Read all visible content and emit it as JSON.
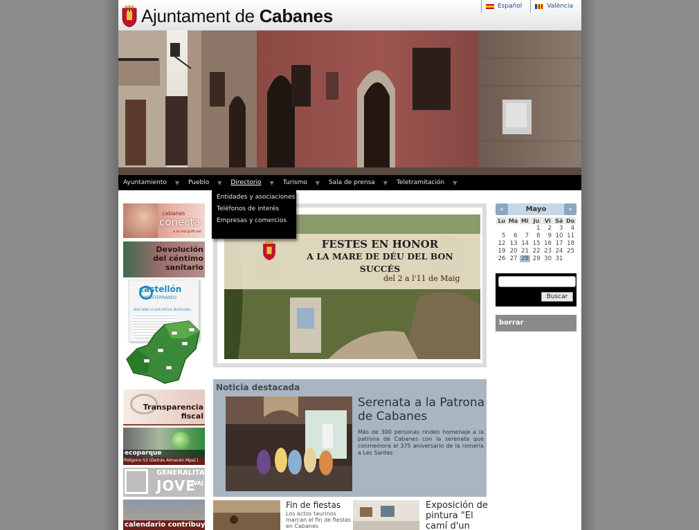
{
  "header": {
    "title_prefix": "Ajuntament de ",
    "title_bold": "Cabanes"
  },
  "languages": [
    {
      "label": "Español"
    },
    {
      "label": "València"
    }
  ],
  "nav": {
    "items": [
      {
        "label": "Ayuntamiento"
      },
      {
        "label": "Pueblo"
      },
      {
        "label": "Directorio"
      },
      {
        "label": "Turismo"
      },
      {
        "label": "Sala de prensa"
      },
      {
        "label": "Teletramitación"
      }
    ],
    "active": "Directorio"
  },
  "dropdown": {
    "items": [
      {
        "label": "Entidades y asociaciones"
      },
      {
        "label": "Teléfonos de interés"
      },
      {
        "label": "Empresas y comercios"
      }
    ]
  },
  "promos": {
    "conecta": {
      "line1": "cabanes",
      "line2": "conecta",
      "line3": "a la red guifi.net"
    },
    "devolucion": {
      "line1": "Devolución",
      "line2": "del céntimo",
      "line3": "sanitario"
    },
    "castellon": {
      "brand": "castellón",
      "sub": "MEDITERRÁNEO",
      "guide": "DESCUBRE LA GUÍA OFICIAL MULTICANAL"
    },
    "transparencia": {
      "line1": "Transparencia",
      "line2": "fiscal"
    },
    "ecoparque": {
      "line1": "ecoparque",
      "line2": "Polígono S3 (Detrás Almacén Mpal.)"
    },
    "ivaj": {
      "line1": "GENERALITAT",
      "line2": "JOVE",
      "line3": "IVAJ"
    },
    "calendario": {
      "line1": "calendario contribuyente"
    }
  },
  "featured": {
    "line1": "FESTES EN HONOR",
    "line2": "A LA MARE DE DÉU DEL BON SUCCÉS",
    "line3": "del 2 a l'11 de Maig"
  },
  "news": {
    "heading": "Noticia destacada",
    "title": "Serenata a la Patrona de Cabanes",
    "text": "Más de 300 personas rinden homenaje a la patrona de Cabanes con la serenata que conmemora el 375 aniversario de la romería a Les Santes"
  },
  "mini_news": [
    {
      "title": "Fin de fiestas",
      "text": "Los actos taurinos marcan el fin de fiestas en Cabanes"
    },
    {
      "title": "Exposición de pintura \"El camí d'un",
      "text": ""
    }
  ],
  "calendar": {
    "month": "Mayo",
    "prev": "«",
    "next": "»",
    "days": [
      "Lu",
      "Ma",
      "Mi",
      "Ju",
      "Vi",
      "Sá",
      "Do"
    ],
    "weeks": [
      [
        "",
        "",
        "",
        "1",
        "2",
        "3",
        "4"
      ],
      [
        "5",
        "6",
        "7",
        "8",
        "9",
        "10",
        "11"
      ],
      [
        "12",
        "13",
        "14",
        "15",
        "16",
        "17",
        "18"
      ],
      [
        "19",
        "20",
        "21",
        "22",
        "23",
        "24",
        "25"
      ],
      [
        "26",
        "27",
        "28",
        "29",
        "30",
        "31",
        ""
      ]
    ],
    "today": "28"
  },
  "search": {
    "placeholder": "",
    "button": "Buscar"
  },
  "borrar": {
    "label": "borrar"
  },
  "colors": {
    "nav_bg": "#000000",
    "news_bg": "#a9b6c2",
    "calendar_today": "#aabdcc",
    "lang_link": "#1a4c96"
  }
}
